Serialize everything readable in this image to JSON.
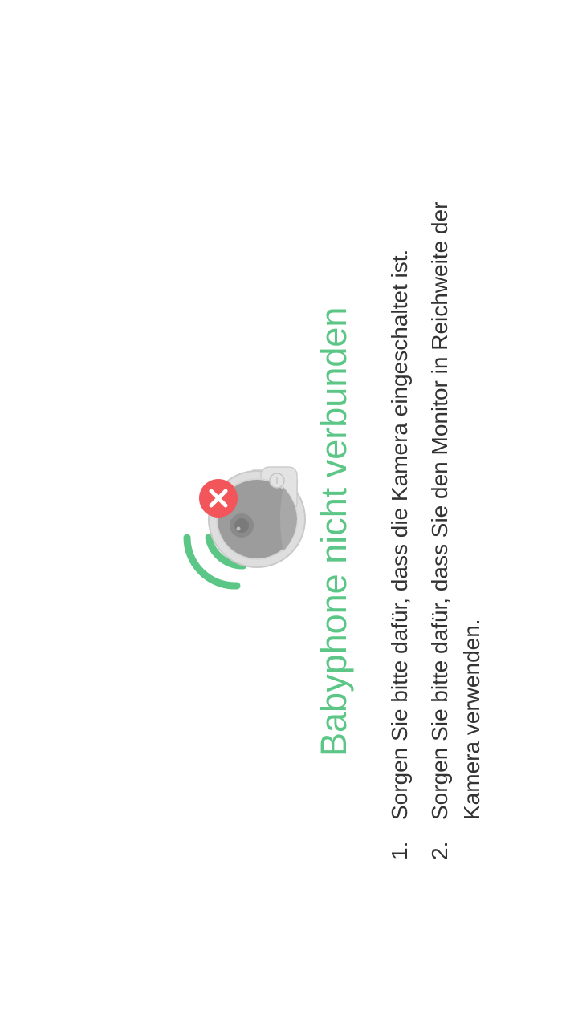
{
  "status": {
    "title": "Babyphone nicht verbunden",
    "icon": "camera-disconnected-icon",
    "accent_color": "#5bc685",
    "error_color": "#f2555a"
  },
  "instructions": [
    {
      "number": "1.",
      "text": "Sorgen Sie bitte dafür, dass die Kamera eingeschaltet ist."
    },
    {
      "number": "2.",
      "text": "Sorgen Sie bitte dafür, dass Sie den Monitor in Reichweite der Kamera verwenden."
    }
  ]
}
